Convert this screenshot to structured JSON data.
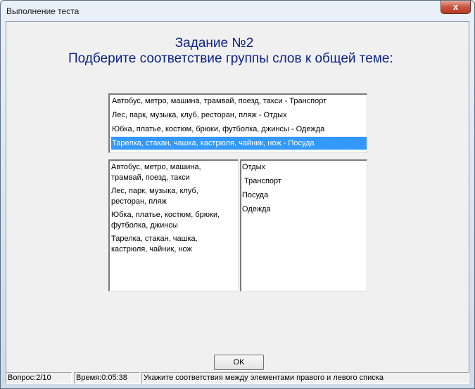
{
  "window": {
    "title": "Выполнение теста",
    "close_label": "x"
  },
  "task": {
    "heading": "Задание №2",
    "instruction": "Подберите соответствие группы слов к общей теме:"
  },
  "answers": [
    "Автобус, метро, машина, трамвай, поезд, такси -  Транспорт",
    "Лес, парк, музыка, клуб, ресторан, пляж - Отдых",
    "Юбка, платье, костюм, брюки, футболка, джинсы - Одежда",
    "Тарелка, стакан, чашка, кастрюля, чайник, нож - Посуда"
  ],
  "selected_answer_index": 3,
  "left_items": [
    "Автобус, метро, машина, трамвай, поезд, такси",
    "Лес, парк, музыка, клуб, ресторан, пляж",
    "Юбка, платье, костюм, брюки, футболка, джинсы",
    "Тарелка, стакан, чашка, кастрюля, чайник, нож"
  ],
  "right_items": [
    "Отдых",
    " Транспорт",
    "Посуда",
    "Одежда"
  ],
  "ok_label": "OK",
  "status": {
    "question": "Вопрос:2/10",
    "time": "Время:0:05:38",
    "hint": "Укажите соответствия между элементами правого и левого списка"
  }
}
